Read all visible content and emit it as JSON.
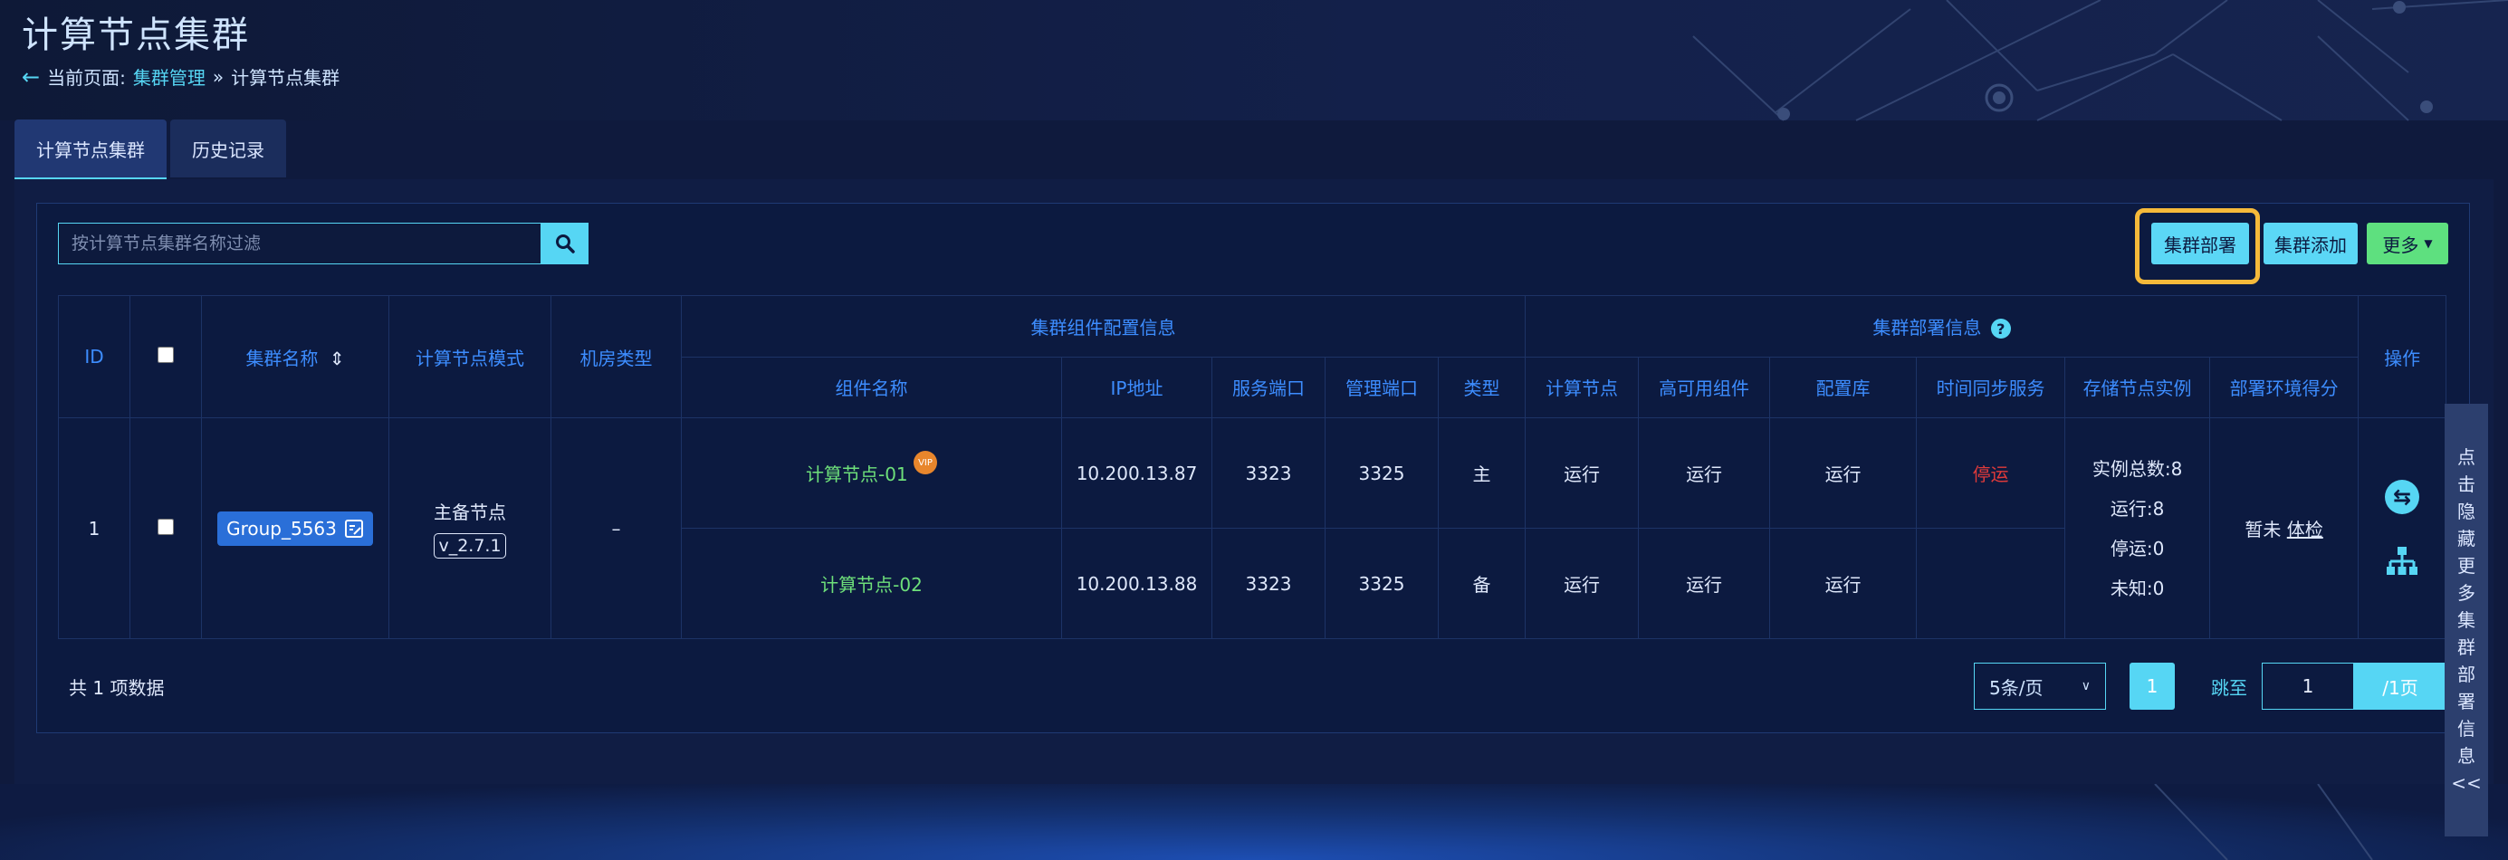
{
  "page": {
    "title": "计算节点集群"
  },
  "breadcrumb": {
    "prefix": "当前页面:",
    "parent": "集群管理",
    "separator": "»",
    "current": "计算节点集群"
  },
  "tabs": [
    {
      "label": "计算节点集群",
      "active": true
    },
    {
      "label": "历史记录",
      "active": false
    }
  ],
  "search": {
    "placeholder": "按计算节点集群名称过滤",
    "value": ""
  },
  "toolbar": {
    "deploy_label": "集群部署",
    "add_label": "集群添加",
    "more_label": "更多"
  },
  "table": {
    "group_headers": {
      "id": "ID",
      "name": "集群名称",
      "mode": "计算节点模式",
      "room_type": "机房类型",
      "component_info": "集群组件配置信息",
      "deploy_info": "集群部署信息",
      "actions": "操作"
    },
    "sub_headers": [
      "组件名称",
      "IP地址",
      "服务端口",
      "管理端口",
      "类型",
      "计算节点",
      "高可用组件",
      "配置库",
      "时间同步服务",
      "存储节点实例",
      "部署环境得分"
    ],
    "row": {
      "id": "1",
      "name": "Group_5563",
      "mode": "主备节点",
      "version": "v_2.7.1",
      "room_type": "–",
      "components": [
        {
          "name": "计算节点-01",
          "badge": "VIP",
          "ip": "10.200.13.87",
          "service_port": "3323",
          "mgmt_port": "3325",
          "type": "主",
          "compute_node": "运行",
          "ha": "运行",
          "config_db": "运行",
          "time_sync": "停运"
        },
        {
          "name": "计算节点-02",
          "ip": "10.200.13.88",
          "service_port": "3323",
          "mgmt_port": "3325",
          "type": "备",
          "compute_node": "运行",
          "ha": "运行",
          "config_db": "运行",
          "time_sync": ""
        }
      ],
      "storage": {
        "total": "实例总数:8",
        "running": "运行:8",
        "stopped": "停运:0",
        "unknown": "未知:0"
      },
      "score": {
        "text": "暂未",
        "link": "体检"
      }
    }
  },
  "footer": {
    "total": "共 1 项数据",
    "page_size": "5条/页",
    "current_page": "1",
    "jump_label": "跳至",
    "jump_value": "1",
    "total_pages": "/1页"
  },
  "side_panel": {
    "chars": [
      "点",
      "击",
      "隐",
      "藏",
      "更",
      "多",
      "集",
      "群",
      "部",
      "署",
      "信",
      "息",
      "<<"
    ]
  },
  "colors": {
    "accent": "#56d6f4",
    "header_blue": "#3d8dff",
    "running_green": "#6ee07a",
    "stopped_red": "#e03a3a",
    "highlight": "#f5b93a"
  }
}
